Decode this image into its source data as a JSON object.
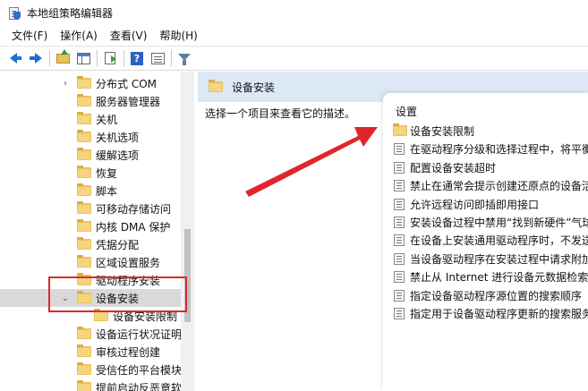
{
  "window": {
    "title": "本地组策略编辑器"
  },
  "menubar": {
    "items": [
      "文件(F)",
      "操作(A)",
      "查看(V)",
      "帮助(H)"
    ]
  },
  "toolbar": {
    "buttons": [
      "back-icon",
      "forward-icon",
      "up-folder-icon",
      "show-hide-tree-icon",
      "export-list-icon",
      "help-icon",
      "view-icon",
      "filter-icon"
    ]
  },
  "tree": {
    "items": [
      {
        "label": "分布式 COM",
        "chevron": "›",
        "level": 1
      },
      {
        "label": "服务器管理器",
        "chevron": "",
        "level": 1
      },
      {
        "label": "关机",
        "chevron": "",
        "level": 1
      },
      {
        "label": "关机选项",
        "chevron": "",
        "level": 1
      },
      {
        "label": "缓解选项",
        "chevron": "",
        "level": 1
      },
      {
        "label": "恢复",
        "chevron": "",
        "level": 1
      },
      {
        "label": "脚本",
        "chevron": "",
        "level": 1
      },
      {
        "label": "可移动存储访问",
        "chevron": "",
        "level": 1
      },
      {
        "label": "内核 DMA 保护",
        "chevron": "",
        "level": 1
      },
      {
        "label": "凭据分配",
        "chevron": "",
        "level": 1
      },
      {
        "label": "区域设置服务",
        "chevron": "",
        "level": 1
      },
      {
        "label": "驱动程序安装",
        "chevron": "",
        "level": 1
      },
      {
        "label": "设备安装",
        "chevron": "⌄",
        "level": 1,
        "selected": true
      },
      {
        "label": "设备安装限制",
        "chevron": "",
        "level": 2
      },
      {
        "label": "设备运行状况证明",
        "chevron": "",
        "level": 1
      },
      {
        "label": "审核过程创建",
        "chevron": "",
        "level": 1
      },
      {
        "label": "受信任的平台模块",
        "chevron": "",
        "level": 1
      },
      {
        "label": "提前启动反恶意软",
        "chevron": "",
        "level": 1
      }
    ]
  },
  "right_pane": {
    "header_title": "设备安装",
    "description": "选择一个项目来查看它的描述。",
    "list_header": "设置",
    "items": [
      {
        "label": "设备安装限制",
        "type": "folder"
      },
      {
        "label": "在驱动程序分级和选择过程中，将平衡",
        "type": "setting"
      },
      {
        "label": "配置设备安装超时",
        "type": "setting"
      },
      {
        "label": "禁止在通常会提示创建还原点的设备活",
        "type": "setting"
      },
      {
        "label": "允许远程访问即插即用接口",
        "type": "setting"
      },
      {
        "label": "安装设备过程中禁用“找到新硬件”气球",
        "type": "setting"
      },
      {
        "label": "在设备上安装通用驱动程序时，不发送",
        "type": "setting"
      },
      {
        "label": "当设备驱动程序在安装过程中请求附加",
        "type": "setting"
      },
      {
        "label": "禁止从 Internet 进行设备元数据检索",
        "type": "setting"
      },
      {
        "label": "指定设备驱动程序源位置的搜索顺序",
        "type": "setting"
      },
      {
        "label": "指定用于设备驱动程序更新的搜索服务",
        "type": "setting"
      }
    ]
  },
  "colors": {
    "annotation_red": "#e0262c",
    "header_bg": "#dce8f5",
    "folder_yellow": "#e9c25f"
  }
}
